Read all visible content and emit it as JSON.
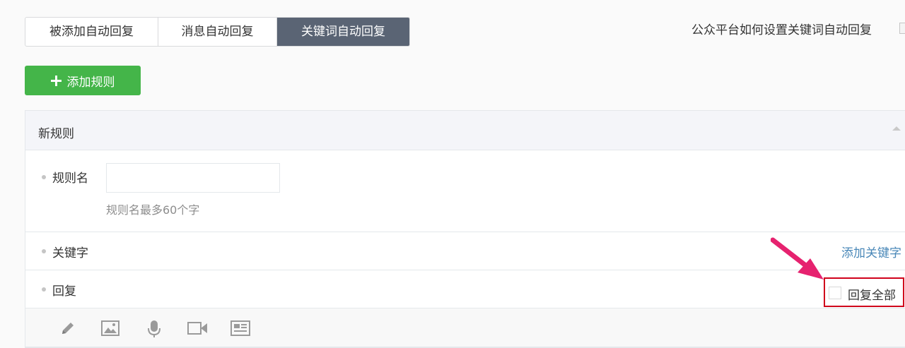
{
  "tabs": [
    {
      "label": "被添加自动回复",
      "active": false
    },
    {
      "label": "消息自动回复",
      "active": false
    },
    {
      "label": "关键词自动回复",
      "active": true
    }
  ],
  "help_link": "公众平台如何设置关键词自动回复",
  "add_rule_button": "添加规则",
  "panel": {
    "title": "新规则",
    "rule_name_label": "规则名",
    "rule_name_value": "",
    "rule_name_hint": "规则名最多60个字",
    "keyword_label": "关键字",
    "add_keyword": "添加关键字",
    "reply_label": "回复",
    "reply_all_label": "回复全部",
    "reply_all_checked": false,
    "reply_types": [
      "pencil-icon",
      "image-icon",
      "microphone-icon",
      "video-icon",
      "news-icon"
    ]
  },
  "colors": {
    "accent_green": "#44b549",
    "active_tab": "#5a6474",
    "link_blue": "#4a88b8",
    "highlight_red": "#d0021b",
    "arrow_pink": "#e6226f"
  }
}
